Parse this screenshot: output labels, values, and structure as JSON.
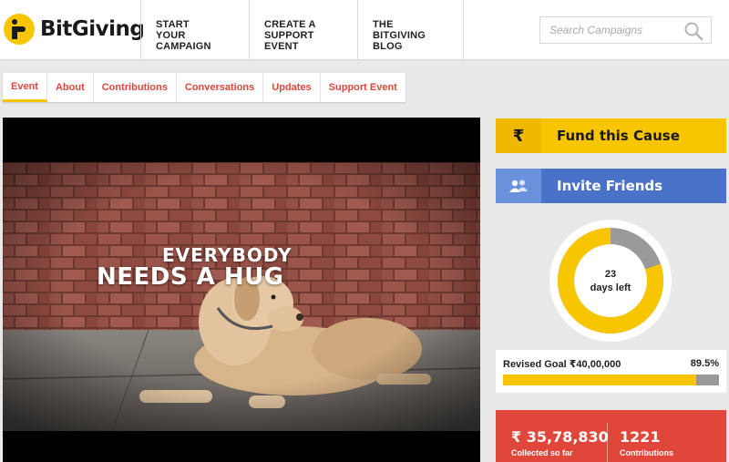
{
  "brand": {
    "name": "BitGiving"
  },
  "nav": [
    {
      "line1": "START",
      "line2": "YOUR CAMPAIGN"
    },
    {
      "line1": "CREATE A",
      "line2": "SUPPORT EVENT"
    },
    {
      "line1": "THE",
      "line2": "BITGIVING BLOG"
    }
  ],
  "search": {
    "placeholder": "Search Campaigns"
  },
  "tabs": [
    {
      "label": "Event",
      "active": true
    },
    {
      "label": "About"
    },
    {
      "label": "Contributions"
    },
    {
      "label": "Conversations"
    },
    {
      "label": "Updates"
    },
    {
      "label": "Support Event"
    }
  ],
  "video": {
    "title_line1": "EVERYBODY",
    "title_line2": "NEEDS A HUG"
  },
  "actions": {
    "fund_icon": "₹",
    "fund_label": "Fund this Cause",
    "invite_label": "Invite Friends",
    "invite_icon": "friends-icon"
  },
  "countdown": {
    "days": "23",
    "days_label": "days left",
    "fraction_remaining": 0.8
  },
  "goal": {
    "label": "Revised Goal ₹40,00,000",
    "percent_label": "89.5%",
    "percent": 89.5
  },
  "stats": {
    "collected": "₹ 35,78,830",
    "collected_label": "Collected so far",
    "contributions": "1221",
    "contributions_label": "Contributions"
  },
  "colors": {
    "accent_yellow": "#f7c600",
    "accent_red": "#e0473a",
    "accent_blue": "#4a72c9",
    "neutral_grey": "#999999"
  }
}
